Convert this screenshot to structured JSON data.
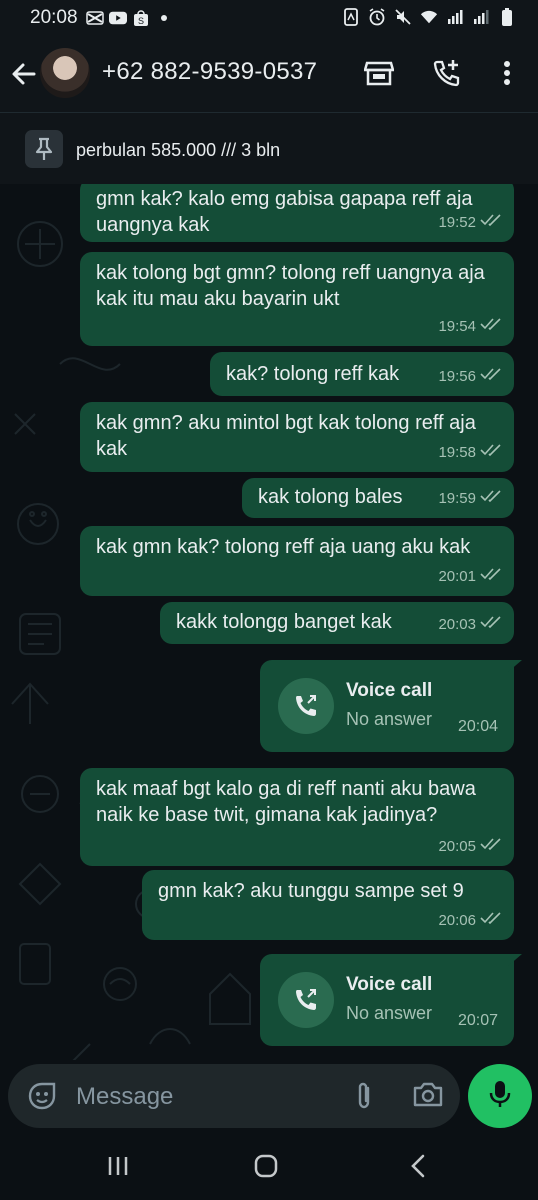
{
  "status_bar": {
    "time": "20:08",
    "left_icons": [
      "capcut-icon",
      "youtube-icon",
      "shopee-icon",
      "dot-icon"
    ],
    "right_icons": [
      "nfc-icon",
      "alarm-icon",
      "mute-icon",
      "wifi-icon",
      "signal-icon",
      "signal-icon",
      "battery-icon"
    ]
  },
  "header": {
    "contact": "+62 882-9539-0537",
    "actions": [
      "shop-icon",
      "add-call-icon",
      "more-icon"
    ]
  },
  "pinned": {
    "text": "perbulan 585.000 /// 3 bln"
  },
  "messages": [
    {
      "text": "gmn kak? kalo emg gabisa gapapa reff aja uangnya kak",
      "time": "19:52"
    },
    {
      "text": "kak tolong bgt gmn? tolong reff uangnya aja kak itu mau aku bayarin ukt",
      "time": "19:54"
    },
    {
      "text": "kak? tolong reff kak",
      "time": "19:56"
    },
    {
      "text": "kak gmn? aku mintol bgt kak tolong reff aja kak",
      "time": "19:58"
    },
    {
      "text": "kak tolong bales",
      "time": "19:59"
    },
    {
      "text": "kak gmn kak? tolong reff aja uang aku kak",
      "time": "20:01"
    },
    {
      "text": "kakk tolongg banget kak",
      "time": "20:03"
    },
    {
      "text": "kak maaf bgt kalo ga di reff nanti aku bawa naik ke base twit, gimana kak jadinya?",
      "time": "20:05"
    },
    {
      "text": "gmn kak? aku tunggu sampe set 9",
      "time": "20:06"
    }
  ],
  "calls": [
    {
      "title": "Voice call",
      "status": "No answer",
      "time": "20:04"
    },
    {
      "title": "Voice call",
      "status": "No answer",
      "time": "20:07"
    }
  ],
  "input": {
    "placeholder": "Message"
  },
  "colors": {
    "bubble": "#144d37",
    "background": "#0b1014",
    "accent": "#21c063",
    "read_ticks": "#a6c2b5"
  }
}
